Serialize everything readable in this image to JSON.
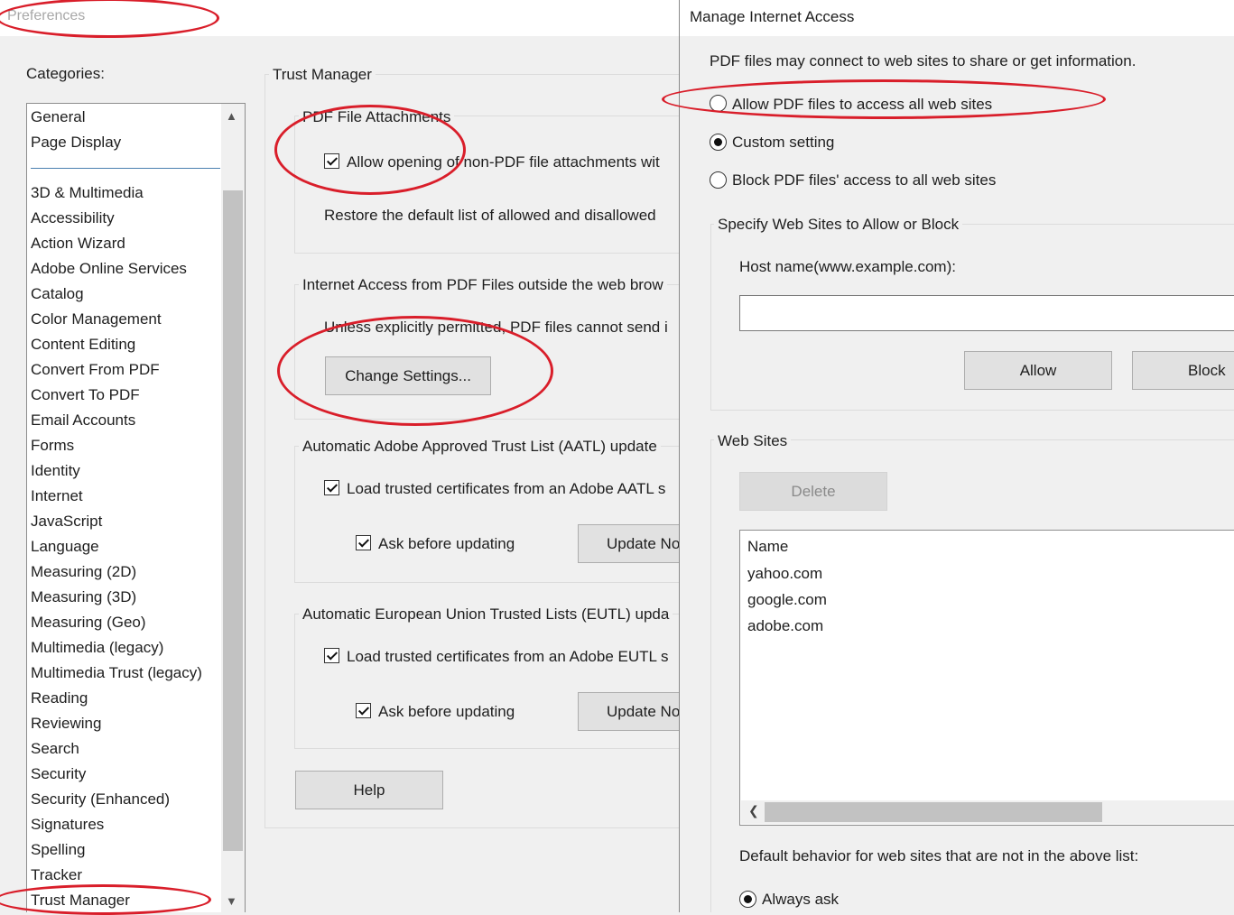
{
  "preferences": {
    "title": "Preferences",
    "categories_label": "Categories:",
    "categories_top": [
      "General",
      "Page Display"
    ],
    "categories": [
      "3D & Multimedia",
      "Accessibility",
      "Action Wizard",
      "Adobe Online Services",
      "Catalog",
      "Color Management",
      "Content Editing",
      "Convert From PDF",
      "Convert To PDF",
      "Email Accounts",
      "Forms",
      "Identity",
      "Internet",
      "JavaScript",
      "Language",
      "Measuring (2D)",
      "Measuring (3D)",
      "Measuring (Geo)",
      "Multimedia (legacy)",
      "Multimedia Trust (legacy)",
      "Reading",
      "Reviewing",
      "Search",
      "Security",
      "Security (Enhanced)",
      "Signatures",
      "Spelling",
      "Tracker",
      "Trust Manager"
    ],
    "panel_title": "Trust Manager",
    "attachments": {
      "group_label": "PDF File Attachments",
      "checkbox_label": "Allow opening of non-PDF file attachments wit",
      "restore_text": "Restore the default list of allowed and disallowed"
    },
    "internet_access": {
      "group_label": "Internet Access from PDF Files outside the web brow",
      "text": "Unless explicitly permitted, PDF files cannot send i",
      "button": "Change Settings..."
    },
    "aatl": {
      "group_label": "Automatic Adobe Approved Trust List (AATL) update",
      "load_label": "Load trusted certificates from an Adobe AATL s",
      "ask_label": "Ask before updating",
      "update_button": "Update No"
    },
    "eutl": {
      "group_label": "Automatic European Union Trusted Lists (EUTL) upda",
      "load_label": "Load trusted certificates from an Adobe EUTL s",
      "ask_label": "Ask before updating",
      "update_button": "Update No"
    },
    "help_button": "Help"
  },
  "manage_internet_access": {
    "title": "Manage Internet Access",
    "intro": "PDF files may connect to web sites to share or get information.",
    "options": [
      {
        "label": "Allow PDF files to access all web sites",
        "selected": false
      },
      {
        "label": "Custom setting",
        "selected": true
      },
      {
        "label": "Block PDF files' access to all web sites",
        "selected": false
      }
    ],
    "specify_group": "Specify Web Sites to Allow or Block",
    "host_label": "Host name(www.example.com):",
    "host_value": "",
    "allow_button": "Allow",
    "block_button": "Block",
    "websites_group": "Web Sites",
    "delete_button": "Delete",
    "sites_header": "Name",
    "sites": [
      "yahoo.com",
      "google.com",
      "adobe.com"
    ],
    "default_behavior_label": "Default behavior for web sites that are not in the above list:",
    "default_option": "Always ask"
  }
}
